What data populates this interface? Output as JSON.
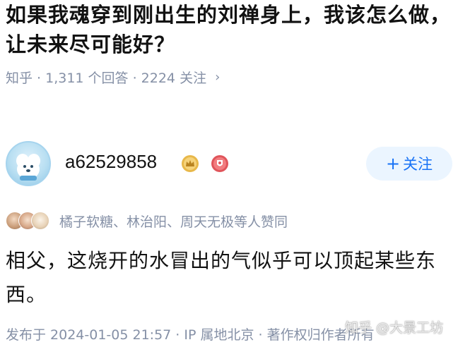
{
  "question": {
    "title": "如果我魂穿到刚出生的刘禅身上，我该怎么做，让未来尽可能好？",
    "meta": "知乎 · 1,311 个回答 · 2224 关注",
    "chevron": "›"
  },
  "author": {
    "name": "a62529858",
    "follow_plus": "+",
    "follow_label": "关注"
  },
  "likers": {
    "text": "橘子软糖、林治阳、周天无极等人赞同"
  },
  "answer": {
    "body": "相父，这烧开的水冒出的气似乎可以顶起某些东西。",
    "footer": "发布于 2024-01-05 21:57 · IP 属地北京 · 著作权归作者所有"
  },
  "watermark": {
    "text": "知乎 @大景工坊"
  },
  "colors": {
    "accent": "#1772f6",
    "follow_bg": "#ebf5ff",
    "meta_gray": "#8590a6",
    "text": "#121212"
  },
  "icons": {
    "gold_badge": "crown-badge-icon",
    "red_badge": "medal-badge-icon",
    "meta_chevron": "chevron-right-icon"
  }
}
